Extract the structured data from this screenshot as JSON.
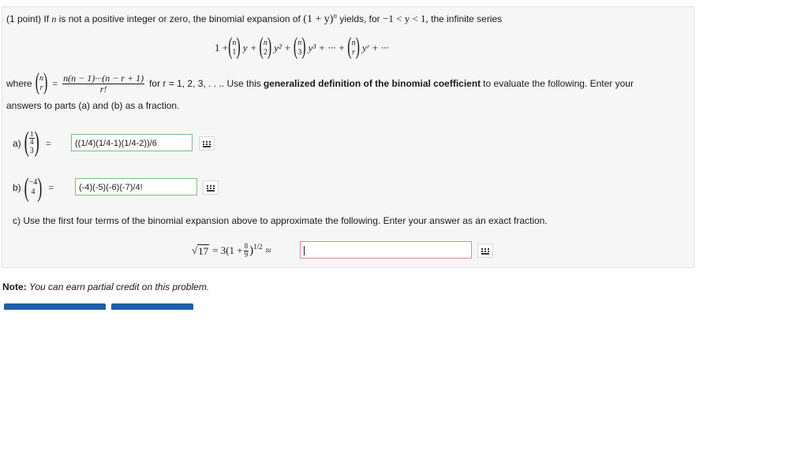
{
  "problem": {
    "intro_prefix": "(1 point) If",
    "intro_n": "n",
    "intro_mid": "is not a positive integer or zero, the binomial expansion of",
    "intro_expr": "(1 + y)",
    "intro_exp": "n",
    "intro_yields": "yields, for",
    "intro_range": "−1 < y < 1,",
    "intro_tail": "the infinite series",
    "series": {
      "lead": "1 +",
      "t1": "y +",
      "t2": "y² +",
      "t3": "y³ + ··· +",
      "tr": "yʳ + ···",
      "top": "n",
      "b1": "1",
      "b2": "2",
      "b3": "3",
      "br": "r"
    },
    "where_label": "where",
    "def_num": "n(n − 1)···(n − r + 1)",
    "def_den": "r!",
    "def_binom_top": "n",
    "def_binom_bot": "r",
    "for_text": "for r = 1, 2, 3, . . .. Use this",
    "bold_text": "generalized definition of the binomial coefficient",
    "after_bold": "to evaluate the following. Enter your",
    "line2": "answers to parts (a) and (b) as a fraction."
  },
  "part_a": {
    "label": "a)",
    "top_num": "1",
    "top_den": "4",
    "bot": "3",
    "eq": "=",
    "answer": "((1/4)(1/4-1)(1/4-2))/6"
  },
  "part_b": {
    "label": "b)",
    "top": "−4",
    "bot": "4",
    "eq": "=",
    "answer": "(-4)(-5)(-6)(-7)/4!"
  },
  "part_c": {
    "text": "c) Use the first four terms of the binomial expansion above to approximate the following. Enter your answer as an exact fraction.",
    "sqrt_arg": "17",
    "expr_lead": "= 3(1 +",
    "frac_num": "8",
    "frac_den": "9",
    "expr_close": ")",
    "exponent": "1/2",
    "approx": "≈",
    "answer": ""
  },
  "note": {
    "label": "Note:",
    "text": "You can earn partial credit on this problem."
  },
  "colors": {
    "correct_border": "#7bbf7b",
    "incorrect_border": "#e58a8a",
    "button": "#1d5fa6"
  }
}
